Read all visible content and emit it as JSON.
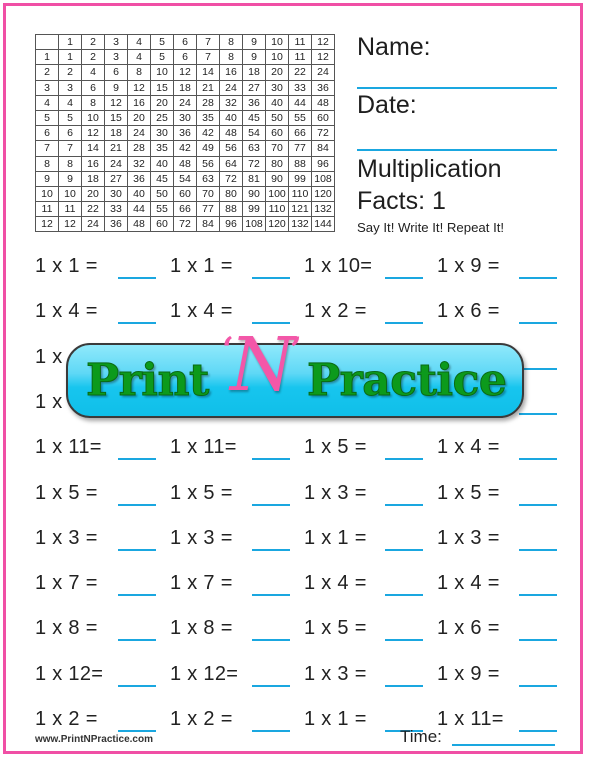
{
  "colors": {
    "border": "#f04fa5",
    "answer_line": "#1aa7e0",
    "logo_green": "#0c9a1c",
    "logo_pink": "#f357a8",
    "logo_blue": "#17c5ee"
  },
  "times_table": {
    "header": [
      "",
      "1",
      "2",
      "3",
      "4",
      "5",
      "6",
      "7",
      "8",
      "9",
      "10",
      "11",
      "12"
    ],
    "rows": [
      [
        "1",
        "1",
        "2",
        "3",
        "4",
        "5",
        "6",
        "7",
        "8",
        "9",
        "10",
        "11",
        "12"
      ],
      [
        "2",
        "2",
        "4",
        "6",
        "8",
        "10",
        "12",
        "14",
        "16",
        "18",
        "20",
        "22",
        "24"
      ],
      [
        "3",
        "3",
        "6",
        "9",
        "12",
        "15",
        "18",
        "21",
        "24",
        "27",
        "30",
        "33",
        "36"
      ],
      [
        "4",
        "4",
        "8",
        "12",
        "16",
        "20",
        "24",
        "28",
        "32",
        "36",
        "40",
        "44",
        "48"
      ],
      [
        "5",
        "5",
        "10",
        "15",
        "20",
        "25",
        "30",
        "35",
        "40",
        "45",
        "50",
        "55",
        "60"
      ],
      [
        "6",
        "6",
        "12",
        "18",
        "24",
        "30",
        "36",
        "42",
        "48",
        "54",
        "60",
        "66",
        "72"
      ],
      [
        "7",
        "7",
        "14",
        "21",
        "28",
        "35",
        "42",
        "49",
        "56",
        "63",
        "70",
        "77",
        "84"
      ],
      [
        "8",
        "8",
        "16",
        "24",
        "32",
        "40",
        "48",
        "56",
        "64",
        "72",
        "80",
        "88",
        "96"
      ],
      [
        "9",
        "9",
        "18",
        "27",
        "36",
        "45",
        "54",
        "63",
        "72",
        "81",
        "90",
        "99",
        "108"
      ],
      [
        "10",
        "10",
        "20",
        "30",
        "40",
        "50",
        "60",
        "70",
        "80",
        "90",
        "100",
        "110",
        "120"
      ],
      [
        "11",
        "11",
        "22",
        "33",
        "44",
        "55",
        "66",
        "77",
        "88",
        "99",
        "110",
        "121",
        "132"
      ],
      [
        "12",
        "12",
        "24",
        "36",
        "48",
        "60",
        "72",
        "84",
        "96",
        "108",
        "120",
        "132",
        "144"
      ]
    ]
  },
  "header": {
    "name_label": "Name:",
    "date_label": "Date:",
    "title_line1": "Multiplication",
    "title_line2": "Facts: 1",
    "slogan": "Say It! Write It! Repeat It!"
  },
  "problems": [
    [
      "1 x 1 =",
      "1 x 1 =",
      "1 x 10=",
      "1 x 9 ="
    ],
    [
      "1 x 4 =",
      "1 x 4 =",
      "1 x 2 =",
      "1 x 6 ="
    ],
    [
      "1 x",
      "",
      "",
      ""
    ],
    [
      "1 x",
      "",
      "",
      ""
    ],
    [
      "1 x 11=",
      "1 x 11=",
      "1 x 5 =",
      "1 x 4 ="
    ],
    [
      "1 x 5 =",
      "1 x 5 =",
      "1 x 3 =",
      "1 x 5 ="
    ],
    [
      "1 x 3 =",
      "1 x 3 =",
      "1 x 1 =",
      "1 x 3 ="
    ],
    [
      "1 x 7 =",
      "1 x 7 =",
      "1 x 4 =",
      "1 x 4 ="
    ],
    [
      "1 x 8 =",
      "1 x 8 =",
      "1 x 5 =",
      "1 x 6 ="
    ],
    [
      "1 x 12=",
      "1 x 12=",
      "1 x 3 =",
      "1 x 9 ="
    ],
    [
      "1 x 2 =",
      "1 x 2 =",
      "1 x 1 =",
      "1 x 11="
    ]
  ],
  "logo": {
    "word1": "Print",
    "quote_open": "‘",
    "letter": "N",
    "quote_close": "’",
    "word2": "Practice"
  },
  "footer": {
    "url": "www.PrintNPractice.com",
    "time_label": "Time:"
  }
}
